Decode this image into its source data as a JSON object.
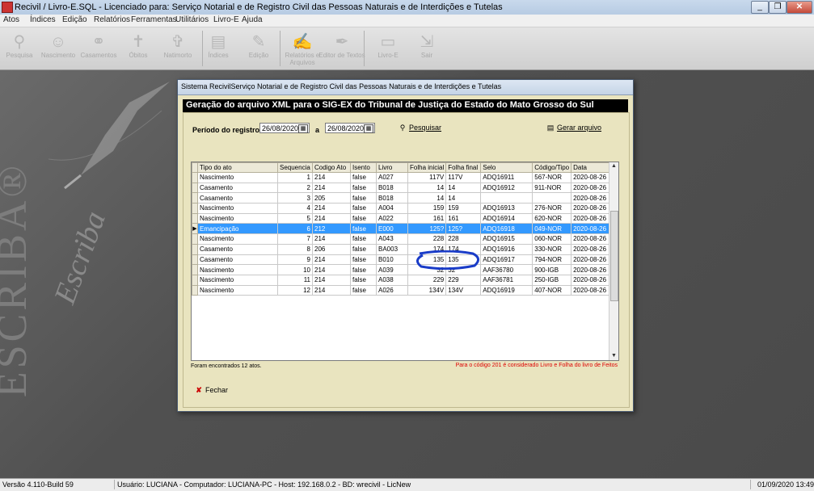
{
  "window": {
    "title": "Recivil / Livro-E.SQL - Licenciado para: Serviço Notarial e de Registro Civil das Pessoas Naturais e de Interdições e Tutelas",
    "buttons": [
      "_",
      "❐",
      "✕"
    ]
  },
  "menu": [
    "Atos",
    "Índices",
    "Edição",
    "Relatórios",
    "Ferramentas",
    "Utilitários",
    "Livro-E",
    "Ajuda"
  ],
  "toolbar": [
    {
      "label": "Pesquisa",
      "icon": "search-icon"
    },
    {
      "label": "Nascimento",
      "icon": "baby-icon"
    },
    {
      "label": "Casamentos",
      "icon": "rings-icon"
    },
    {
      "label": "Óbitos",
      "icon": "cross-icon"
    },
    {
      "label": "Natimorto",
      "icon": "cross-small-icon"
    },
    {
      "label": "Índices",
      "icon": "book-icon"
    },
    {
      "label": "Edição",
      "icon": "edit-icon"
    },
    {
      "label": "Relatórios e Arquivos",
      "icon": "report-icon"
    },
    {
      "label": "Editor de Textos",
      "icon": "text-editor-icon"
    },
    {
      "label": "Livro-E",
      "icon": "ebook-icon"
    },
    {
      "label": "Sair",
      "icon": "exit-icon"
    }
  ],
  "background": {
    "brand": "ESCRIBA®",
    "script": "Escriba"
  },
  "dialog": {
    "title": "Sistema RecivilServiço Notarial e de Registro Civil das Pessoas Naturais e de Interdições e Tutelas",
    "header": "Geração do arquivo XML para o SIG-EX do Tribunal de Justiça do Estado do Mato Grosso do Sul",
    "period_label": "Período do registro",
    "date_from": "26/08/2020",
    "date_sep": "a",
    "date_to": "26/08/2020",
    "search_label": "Pesquisar",
    "generate_label": "Gerar arquivo",
    "close_label": "Fechar",
    "found_text": "Foram encontrados 12 atos.",
    "note_text": "Para o código 201 é considerado Livro e Folha do livro de Feitos",
    "columns": [
      "Tipo do ato",
      "Sequencia",
      "Codigo Ato",
      "Isento",
      "Livro",
      "Folha inicial",
      "Folha final",
      "Selo",
      "Código/Tipo",
      "Data"
    ],
    "rows": [
      [
        "Nascimento",
        "1",
        "214",
        "false",
        "A027",
        "117V",
        "117V",
        "ADQ16911",
        "567-NOR",
        "2020-08-26"
      ],
      [
        "Casamento",
        "2",
        "214",
        "false",
        "B018",
        "14",
        "14",
        "ADQ16912",
        "911-NOR",
        "2020-08-26"
      ],
      [
        "Casamento",
        "3",
        "205",
        "false",
        "B018",
        "14",
        "14",
        "",
        "",
        "2020-08-26"
      ],
      [
        "Nascimento",
        "4",
        "214",
        "false",
        "A004",
        "159",
        "159",
        "ADQ16913",
        "276-NOR",
        "2020-08-26"
      ],
      [
        "Nascimento",
        "5",
        "214",
        "false",
        "A022",
        "161",
        "161",
        "ADQ16914",
        "620-NOR",
        "2020-08-26"
      ],
      [
        "Emancipação",
        "6",
        "212",
        "false",
        "E000",
        "125?",
        "125?",
        "ADQ16918",
        "049-NOR",
        "2020-08-26"
      ],
      [
        "Nascimento",
        "7",
        "214",
        "false",
        "A043",
        "228",
        "228",
        "ADQ16915",
        "060-NOR",
        "2020-08-26"
      ],
      [
        "Casamento",
        "8",
        "206",
        "false",
        "BA003",
        "174",
        "174",
        "ADQ16916",
        "330-NOR",
        "2020-08-26"
      ],
      [
        "Casamento",
        "9",
        "214",
        "false",
        "B010",
        "135",
        "135",
        "ADQ16917",
        "794-NOR",
        "2020-08-26"
      ],
      [
        "Nascimento",
        "10",
        "214",
        "false",
        "A039",
        "32",
        "32",
        "AAF36780",
        "900-IGB",
        "2020-08-26"
      ],
      [
        "Nascimento",
        "11",
        "214",
        "false",
        "A038",
        "229",
        "229",
        "AAF36781",
        "250-IGB",
        "2020-08-26"
      ],
      [
        "Nascimento",
        "12",
        "214",
        "false",
        "A026",
        "134V",
        "134V",
        "ADQ16919",
        "407-NOR",
        "2020-08-26"
      ]
    ],
    "selected_row": 5
  },
  "status": {
    "version": "Versão 4.110-Build 59",
    "info": "Usuário: LUCIANA - Computador: LUCIANA-PC - Host: 192.168.0.2 - BD: wrecivil - LicNew",
    "datetime": "01/09/2020 13:49"
  },
  "colors": {
    "selection": "#3399ff",
    "dialog_bg": "#e9e4bf",
    "header_bg": "#000000",
    "note": "#dd0000",
    "annotation": "#1a3cc8"
  }
}
